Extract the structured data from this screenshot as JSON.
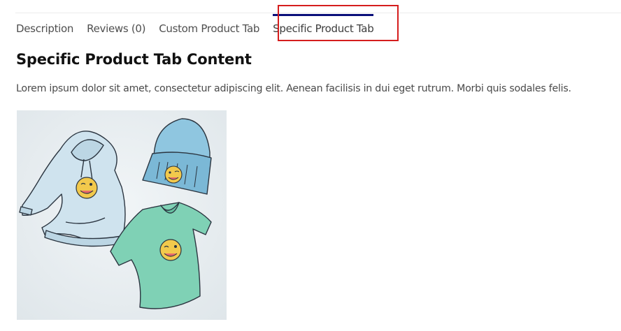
{
  "tabs": [
    {
      "label": "Description",
      "active": false
    },
    {
      "label": "Reviews (0)",
      "active": false
    },
    {
      "label": "Custom Product Tab",
      "active": false
    },
    {
      "label": "Specific Product Tab",
      "active": true
    }
  ],
  "content": {
    "heading": "Specific Product Tab Content",
    "paragraph": "Lorem ipsum dolor sit amet, consectetur adipiscing elit. Aenean facilisis in dui eget rutrum. Morbi quis sodales felis."
  },
  "colors": {
    "active_tab_indicator": "#0a0f7a",
    "highlight_box": "#d51d1d"
  },
  "image": {
    "items": [
      "hoodie",
      "beanie",
      "t-shirt",
      "winking-emoji"
    ]
  }
}
